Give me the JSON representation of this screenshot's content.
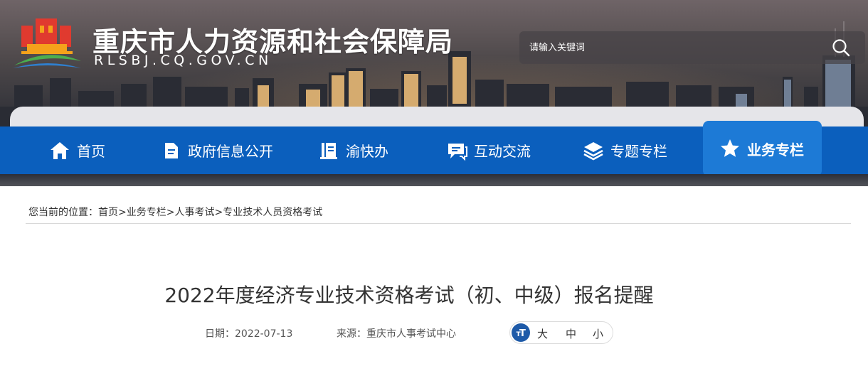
{
  "header": {
    "site_title": "重庆市人力资源和社会保障局",
    "site_url": "RLSBJ.CQ.GOV.CN",
    "search": {
      "placeholder": "请输入关键词",
      "value": ""
    }
  },
  "nav": {
    "items": [
      {
        "label": "首页",
        "icon": "home-icon"
      },
      {
        "label": "政府信息公开",
        "icon": "document-icon"
      },
      {
        "label": "渝快办",
        "icon": "service-book-icon"
      },
      {
        "label": "互动交流",
        "icon": "chat-icon"
      },
      {
        "label": "专题专栏",
        "icon": "layers-icon"
      },
      {
        "label": "业务专栏",
        "icon": "star-icon",
        "active": true
      }
    ]
  },
  "breadcrumb": {
    "prefix": "您当前的位置：",
    "items": [
      "首页",
      "业务专栏",
      "人事考试",
      "专业技术人员资格考试"
    ],
    "separator": ">"
  },
  "article": {
    "title": "2022年度经济专业技术资格考试（初、中级）报名提醒",
    "date_label": "日期：",
    "date": "2022-07-13",
    "source_label": "来源：",
    "source": "重庆市人事考试中心",
    "font_size_options": [
      "大",
      "中",
      "小"
    ]
  },
  "colors": {
    "nav_bg": "#0b5fbd",
    "nav_active_bg": "#1d7ad6",
    "logo_red": "#e03a2f",
    "logo_orange": "#f5a21b",
    "logo_green": "#4bae4f",
    "font_icon_bg": "#1e5aa8"
  }
}
